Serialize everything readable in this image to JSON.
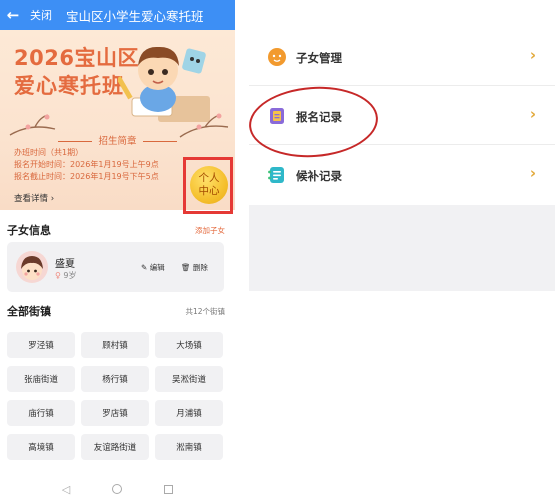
{
  "header": {
    "back_icon": "arrow-left-icon",
    "close_label": "关闭",
    "title": "宝山区小学生爱心寒托班"
  },
  "banner": {
    "title_line1": "2026宝山区",
    "title_line2": "爱心寒托班",
    "subtitle": "招生简章",
    "info_lines": [
      "办班时间（共1期）",
      "报名开始时间：2026年1月19号上午9点",
      "报名截止时间：2026年1月19号下午5点"
    ],
    "detail_link": "查看详情 ›",
    "personal_center": [
      "个人",
      "中心"
    ],
    "accent_color": "#e46b3f"
  },
  "children": {
    "heading": "子女信息",
    "add_link": "添加子女",
    "items": [
      {
        "name": "盛夏",
        "age": "9岁",
        "edit_label": "编辑",
        "delete_label": "删除"
      }
    ]
  },
  "towns": {
    "heading": "全部街镇",
    "count_label": "共12个街镇",
    "items": [
      "罗泾镇",
      "顾村镇",
      "大场镇",
      "张庙街道",
      "杨行镇",
      "吴淞街道",
      "庙行镇",
      "罗店镇",
      "月浦镇",
      "高境镇",
      "友谊路街道",
      "淞南镇"
    ]
  },
  "system_nav": {
    "icons": [
      "back-triangle-icon",
      "home-circle-icon",
      "recent-square-icon"
    ]
  },
  "right_menu": {
    "items": [
      {
        "label": "子女管理",
        "icon": "child-face-icon"
      },
      {
        "label": "报名记录",
        "icon": "notebook-icon"
      },
      {
        "label": "候补记录",
        "icon": "waitlist-icon"
      }
    ],
    "chevron": "›",
    "highlight_color": "#c62828"
  }
}
